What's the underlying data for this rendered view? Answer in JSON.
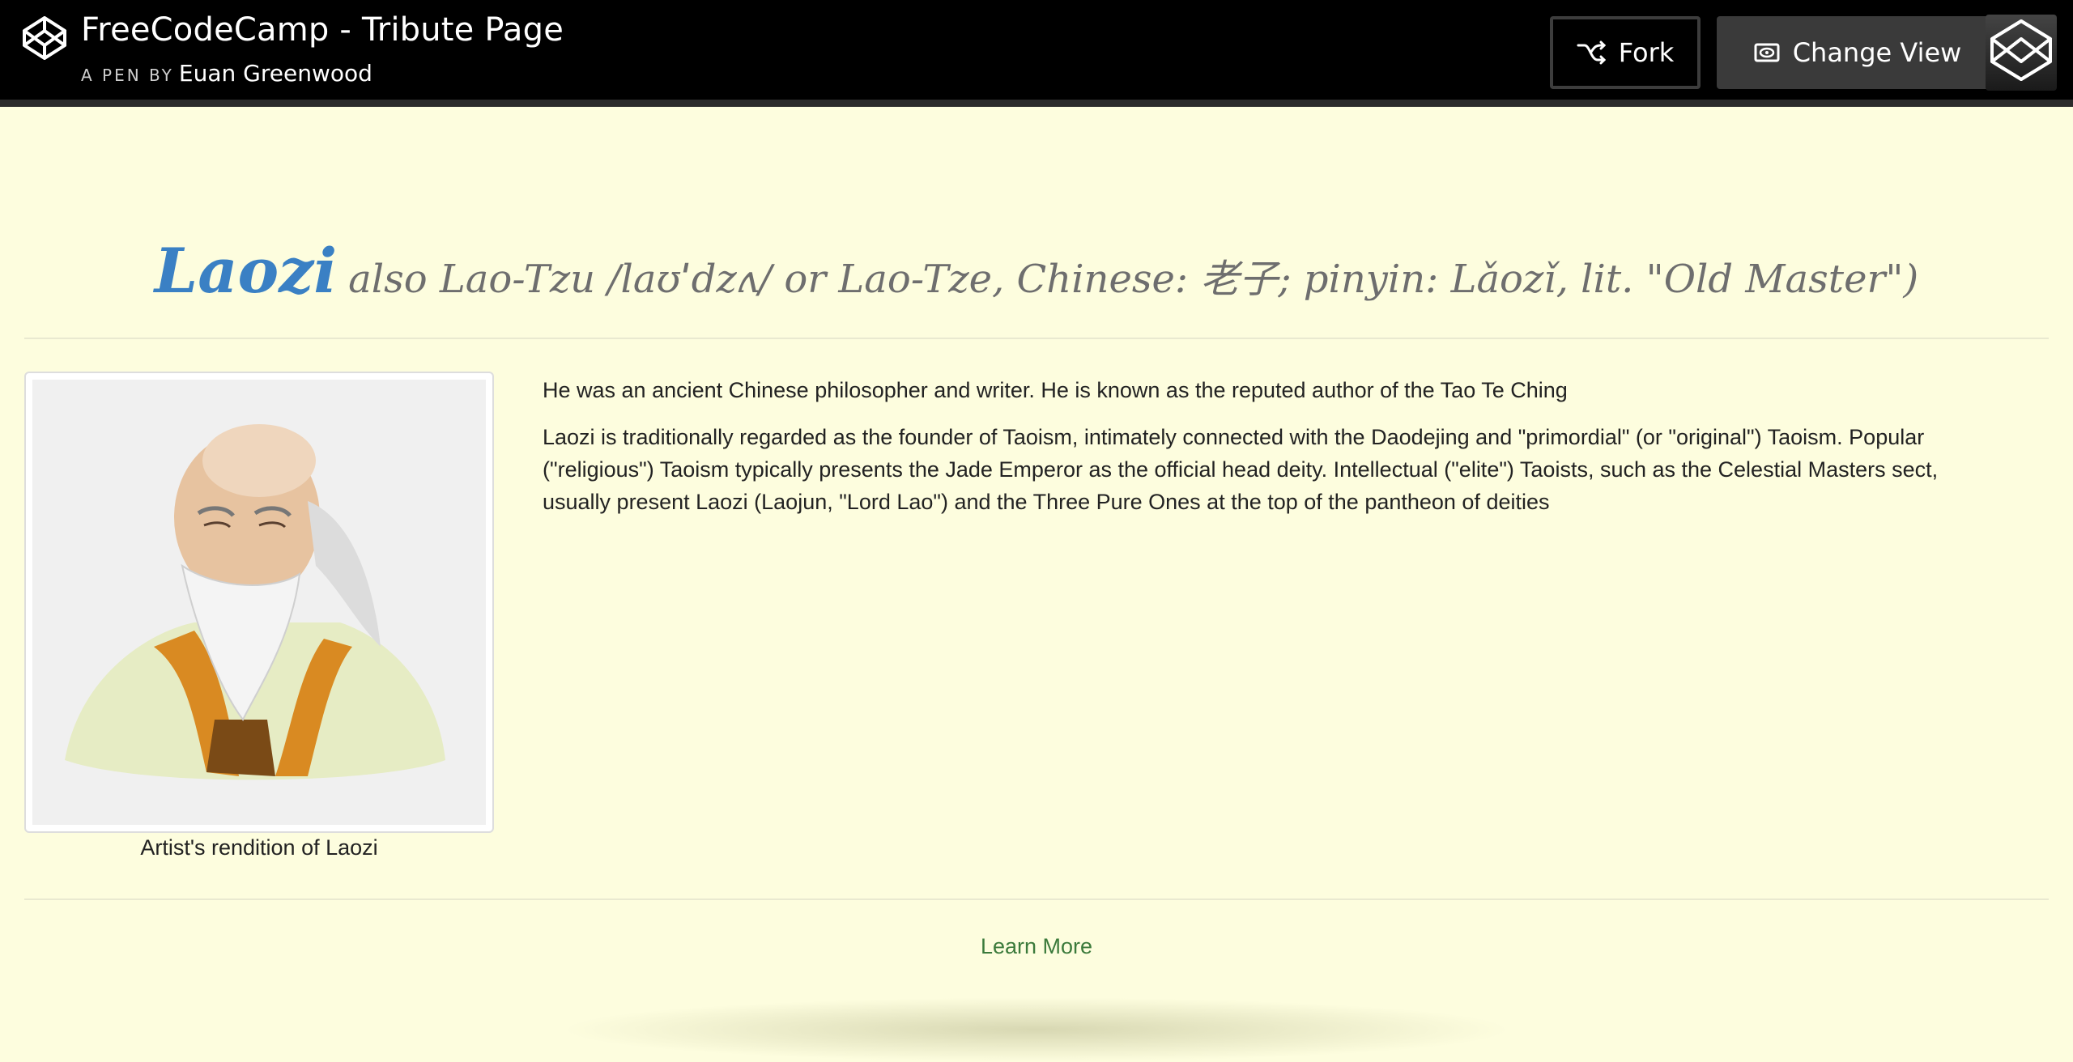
{
  "header": {
    "pen_title": "FreeCodeCamp - Tribute Page",
    "by_label": "A PEN BY",
    "author": "Euan Greenwood",
    "fork_label": "Fork",
    "change_view_label": "Change View"
  },
  "tribute": {
    "name": "Laozi",
    "subtitle": "also Lao-Tzu /laʊˈdzʌ/ or Lao-Tze, Chinese: 老子; pinyin: Lǎozǐ, lit. \"Old Master\")",
    "caption": "Artist's rendition of Laozi",
    "paragraphs": [
      "He was an ancient Chinese philosopher and writer. He is known as the reputed author of the Tao Te Ching",
      "Laozi is traditionally regarded as the founder of Taoism, intimately connected with the Daodejing and \"primordial\" (or \"original\") Taoism. Popular (\"religious\") Taoism typically presents the Jade Emperor as the official head deity. Intellectual (\"elite\") Taoists, such as the Celestial Masters sect, usually present Laozi (Laojun, \"Lord Lao\") and the Three Pure Ones at the top of the pantheon of deities"
    ],
    "learn_more": "Learn More"
  },
  "icons": {
    "logo": "codepen-logo-icon",
    "fork": "fork-icon",
    "view": "eye-icon",
    "avatar": "avatar-codepen-icon"
  },
  "colors": {
    "page_bg": "#fdfdde",
    "name": "#3a80c4",
    "link": "#3b7a3b"
  }
}
